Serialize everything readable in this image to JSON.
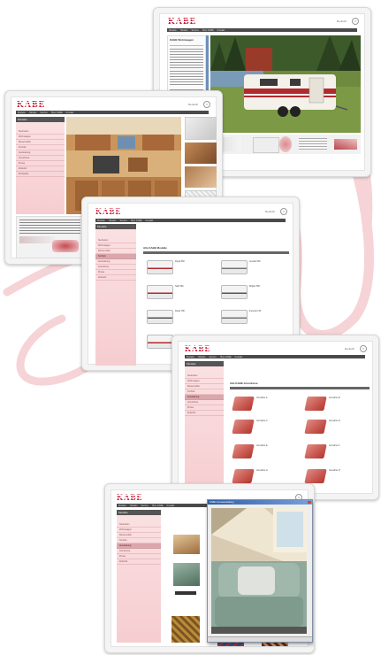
{
  "brand": {
    "name": "KABE",
    "accent": "#c8102e",
    "sidebar_tint": "#f6cdd0"
  },
  "screens": [
    {
      "lang": "Deutsch",
      "close": "×",
      "nav": [
        "Modelle",
        "Händler",
        "Service",
        "Über KABE",
        "Kontakt"
      ],
      "sidebar": [
        "Neuheiten",
        "Wohnwagen",
        "Reisemobile",
        "Zubehör",
        "Service",
        "Kontakt"
      ],
      "panel_title": "KABE Wohnwagen",
      "content": "exterior-caravan-photo"
    },
    {
      "lang": "Deutsch",
      "close": "×",
      "nav": [
        "Modelle",
        "Händler",
        "Service",
        "Über KABE",
        "Kontakt"
      ],
      "sidebar_header": "Modelle",
      "sidebar": [
        "Neuheiten",
        "Wohnwagen",
        "Reisemobile",
        "Technik",
        "Ausstattung",
        "Grundrisse",
        "Preise",
        "Zubehör",
        "Prospekte"
      ],
      "content": "interior-kitchen-photo"
    },
    {
      "lang": "Deutsch",
      "close": "×",
      "nav": [
        "Modelle",
        "Händler",
        "Service",
        "Über KABE",
        "Kontakt"
      ],
      "sidebar_header": "Modelle",
      "sidebar": [
        "Neuheiten",
        "Wohnwagen",
        "Reisemobile",
        "Technik",
        "Ausstattung",
        "Grundrisse",
        "Preise",
        "Zubehör"
      ],
      "sidebar_selected": 3,
      "section_title": "Alle KABE Modelle",
      "list": [
        "Royal 560",
        "Ametist 540",
        "Safir 560",
        "Briljant 560",
        "Royal 780",
        "Imperial 740",
        "Smaragd 520",
        "Travel Master"
      ],
      "content": "caravan-model-grid"
    },
    {
      "lang": "Deutsch",
      "close": "×",
      "nav": [
        "Modelle",
        "Händler",
        "Service",
        "Über KABE",
        "Kontakt"
      ],
      "sidebar_header": "Modelle",
      "sidebar": [
        "Neuheiten",
        "Wohnwagen",
        "Reisemobile",
        "Technik",
        "Ausstattung",
        "Grundrisse",
        "Preise",
        "Zubehör"
      ],
      "sidebar_selected": 4,
      "section_title": "Alle KABE Grundrisse",
      "list": [
        "Grundriss A",
        "Grundriss B",
        "Grundriss C",
        "Grundriss D",
        "Grundriss E",
        "Grundriss F",
        "Grundriss G",
        "Grundriss H"
      ],
      "content": "floorplan-grid"
    },
    {
      "lang": "Deutsch",
      "close": "×",
      "nav": [
        "Modelle",
        "Händler",
        "Service",
        "Über KABE",
        "Kontakt"
      ],
      "sidebar_header": "Modelle",
      "sidebar": [
        "Neuheiten",
        "Wohnwagen",
        "Reisemobile",
        "Technik",
        "Ausstattung",
        "Grundrisse",
        "Preise",
        "Zubehör"
      ],
      "sidebar_selected": 4,
      "popup_title": "KABE Innenausstattung",
      "content": "upholstery-popup"
    }
  ]
}
